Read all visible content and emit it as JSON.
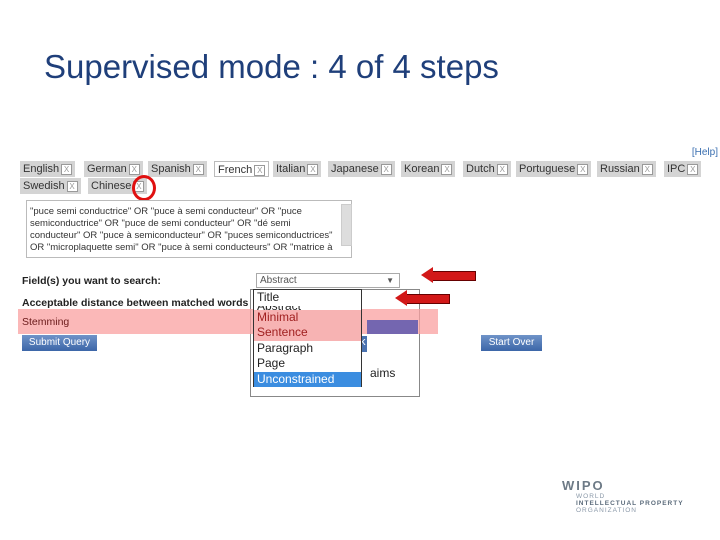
{
  "title": "Supervised mode : 4 of 4 steps",
  "help": "[Help]",
  "tabs": [
    "English",
    "German",
    "Spanish",
    "French",
    "Italian",
    "Japanese",
    "Korean",
    "Dutch",
    "Portuguese",
    "Russian",
    "IPC",
    "Swedish",
    "Chinese"
  ],
  "active_tab": "French",
  "close_glyph": "X",
  "query_text": "\"puce semi conductrice\" OR \"puce à semi conducteur\" OR \"puce semiconductrice\" OR \"puce de semi conducteur\" OR \"dé semi conducteur\" OR \"puce à semiconducteur\" OR \"puces semiconductrices\" OR \"microplaquette semi\" OR \"puce à semi conducteurs\" OR \"matrice à",
  "fields_label": "Field(s) you want to search:",
  "fields_value": "Abstract",
  "distance_label": "Acceptable distance between matched words",
  "stemming_label": "Stemming",
  "dropdown_options": [
    "Title",
    "Abstract",
    "Minimal",
    "Sentence",
    "Paragraph",
    "Page",
    "Unconstrained"
  ],
  "selected_option": "Unconstrained",
  "hidden_text": "aims",
  "hidden_button_fragment": "k",
  "submit_label": "Submit Query",
  "start_over_label": "Start Over",
  "logo": {
    "name": "WIPO",
    "line1": "WORLD",
    "line2": "INTELLECTUAL PROPERTY",
    "line3": "ORGANIZATION"
  },
  "colors": {
    "highlight": "#e01010",
    "title": "#1f3f7a",
    "button": "#4a72b0"
  }
}
